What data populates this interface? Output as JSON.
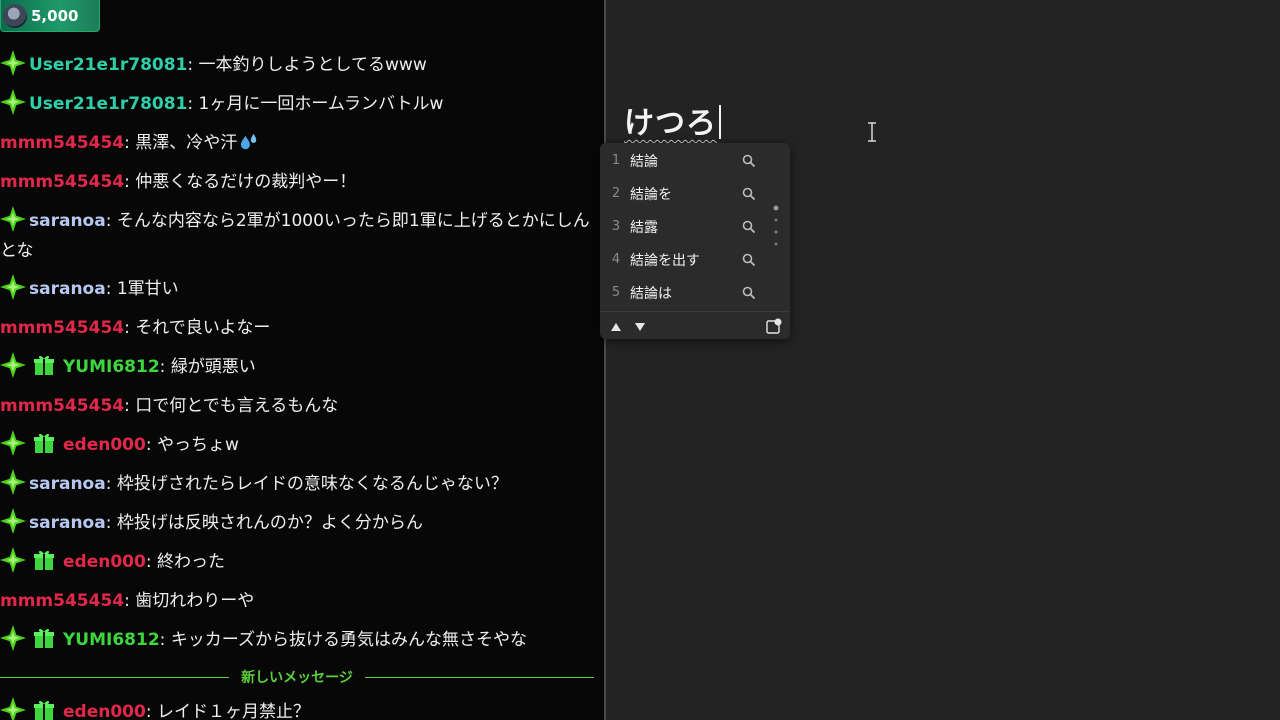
{
  "badge": {
    "points": "5,000"
  },
  "chat": {
    "messages": [
      {
        "user": "User21e1r78081",
        "text": "一本釣りしようとしてるwww"
      },
      {
        "user": "User21e1r78081",
        "text": "1ヶ月に一回ホームランバトルw"
      },
      {
        "user": "mmm545454",
        "text": "黒澤、冷や汗"
      },
      {
        "user": "mmm545454",
        "text": "仲悪くなるだけの裁判やー！"
      },
      {
        "user": "saranoa",
        "text": "そんな内容なら2軍が1000いったら即1軍に上げるとかにしんとな"
      },
      {
        "user": "saranoa",
        "text": "1軍甘い"
      },
      {
        "user": "mmm545454",
        "text": "それで良いよなー"
      },
      {
        "user": "YUMI6812",
        "text": "緑が頭悪い"
      },
      {
        "user": "mmm545454",
        "text": "口で何とでも言えるもんな"
      },
      {
        "user": "eden000",
        "text": "やっちょw"
      },
      {
        "user": "saranoa",
        "text": "枠投げされたらレイドの意味なくなるんじゃない？"
      },
      {
        "user": "saranoa",
        "text": "枠投げは反映されんのか？よく分からん"
      },
      {
        "user": "eden000",
        "text": "終わった"
      },
      {
        "user": "mmm545454",
        "text": "歯切れわりーや"
      },
      {
        "user": "YUMI6812",
        "text": "キッカーズから抜ける勇気はみんな無さそやな"
      },
      {
        "user": "eden000",
        "text": "レイド１ヶ月禁止？"
      }
    ],
    "new_messages_label": "新しいメッセージ"
  },
  "editor": {
    "typed": "けつろ"
  },
  "ime": {
    "candidates": [
      {
        "num": "1",
        "text": "結論"
      },
      {
        "num": "2",
        "text": "結論を"
      },
      {
        "num": "3",
        "text": "結露"
      },
      {
        "num": "4",
        "text": "結論を出す"
      },
      {
        "num": "5",
        "text": "結論は"
      }
    ]
  },
  "colors": {
    "user_teal": "#2ecfa8",
    "user_red": "#e1284a",
    "user_blue": "#b7c8f0",
    "user_green": "#3ed63e",
    "new_separator": "#5ccf3e"
  }
}
